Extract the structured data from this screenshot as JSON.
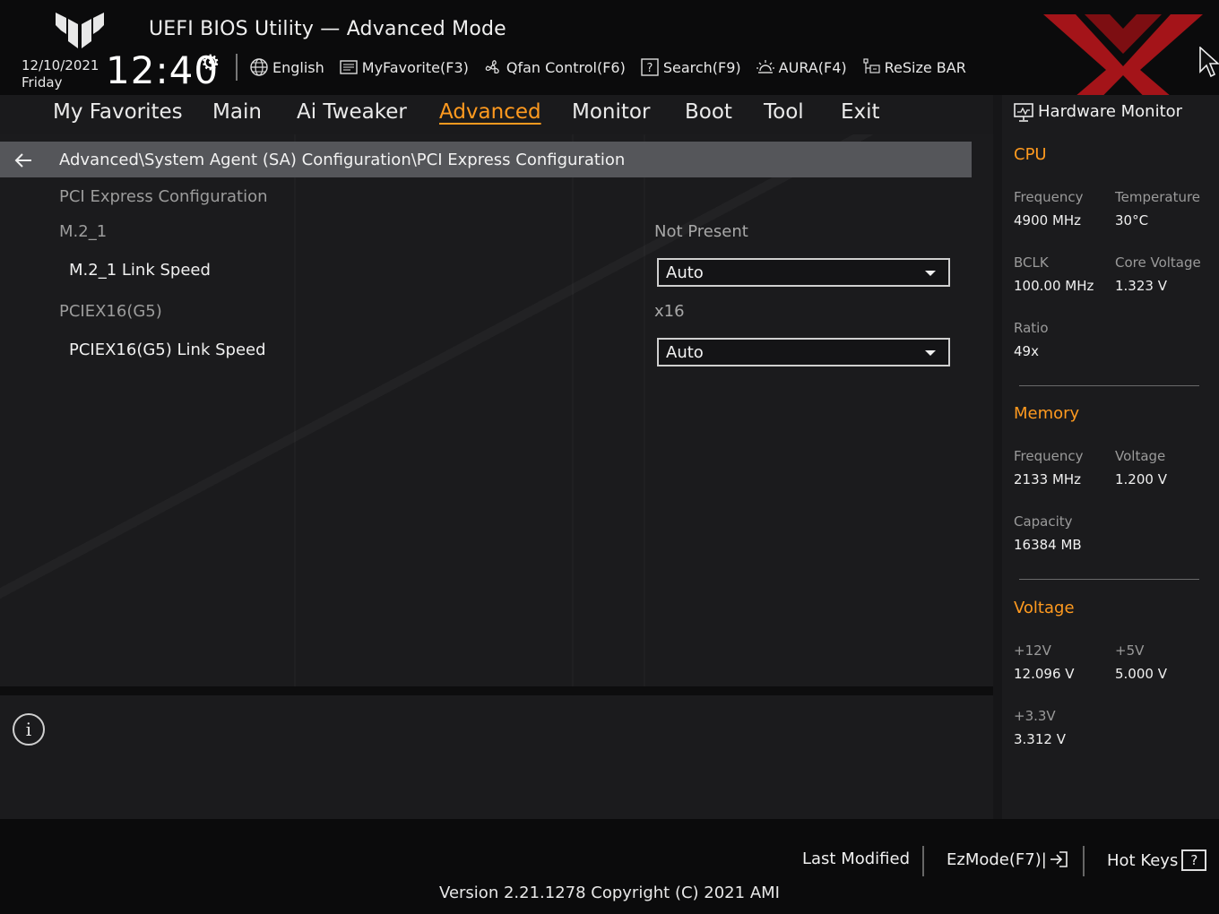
{
  "header": {
    "title": "UEFI BIOS Utility — Advanced Mode",
    "date": "12/10/2021",
    "day": "Friday",
    "time": "12:40",
    "toolbar": [
      {
        "label": "English",
        "icon": "globe-icon"
      },
      {
        "label": "MyFavorite(F3)",
        "icon": "favorite-icon"
      },
      {
        "label": "Qfan Control(F6)",
        "icon": "fan-icon"
      },
      {
        "label": "Search(F9)",
        "icon": "search-help-icon"
      },
      {
        "label": "AURA(F4)",
        "icon": "aura-icon"
      },
      {
        "label": "ReSize BAR",
        "icon": "resize-bar-icon"
      }
    ]
  },
  "nav": {
    "tabs": [
      "My Favorites",
      "Main",
      "Ai Tweaker",
      "Advanced",
      "Monitor",
      "Boot",
      "Tool",
      "Exit"
    ],
    "active": "Advanced"
  },
  "main": {
    "breadcrumb": "Advanced\\System Agent (SA) Configuration\\PCI Express Configuration",
    "section_title": "PCI Express Configuration",
    "rows": [
      {
        "label": "M.2_1",
        "value": "Not Present"
      },
      {
        "label": "M.2_1 Link Speed",
        "selected": "Auto"
      },
      {
        "label": "PCIEX16(G5)",
        "value": "x16"
      },
      {
        "label": "PCIEX16(G5) Link Speed",
        "selected": "Auto"
      }
    ]
  },
  "hw_monitor": {
    "title": "Hardware Monitor",
    "cpu": {
      "heading": "CPU",
      "frequency_label": "Frequency",
      "frequency": "4900 MHz",
      "temperature_label": "Temperature",
      "temperature": "30°C",
      "bclk_label": "BCLK",
      "bclk": "100.00 MHz",
      "core_voltage_label": "Core Voltage",
      "core_voltage": "1.323 V",
      "ratio_label": "Ratio",
      "ratio": "49x"
    },
    "memory": {
      "heading": "Memory",
      "frequency_label": "Frequency",
      "frequency": "2133 MHz",
      "voltage_label": "Voltage",
      "voltage": "1.200 V",
      "capacity_label": "Capacity",
      "capacity": "16384 MB"
    },
    "voltage": {
      "heading": "Voltage",
      "v12_label": "+12V",
      "v12": "12.096 V",
      "v5_label": "+5V",
      "v5": "5.000 V",
      "v33_label": "+3.3V",
      "v33": "3.312 V"
    }
  },
  "footer": {
    "last_modified": "Last Modified",
    "ezmode": "EzMode(F7)|",
    "hot_keys": "Hot Keys",
    "hot_keys_glyph": "?",
    "version": "Version 2.21.1278 Copyright (C) 2021 AMI"
  },
  "colors": {
    "accent": "#ff9a1f",
    "background": "#111113",
    "panel": "#1b1b1d",
    "breadcrumb_bar": "#55565a",
    "watermark": "#c0161c"
  }
}
